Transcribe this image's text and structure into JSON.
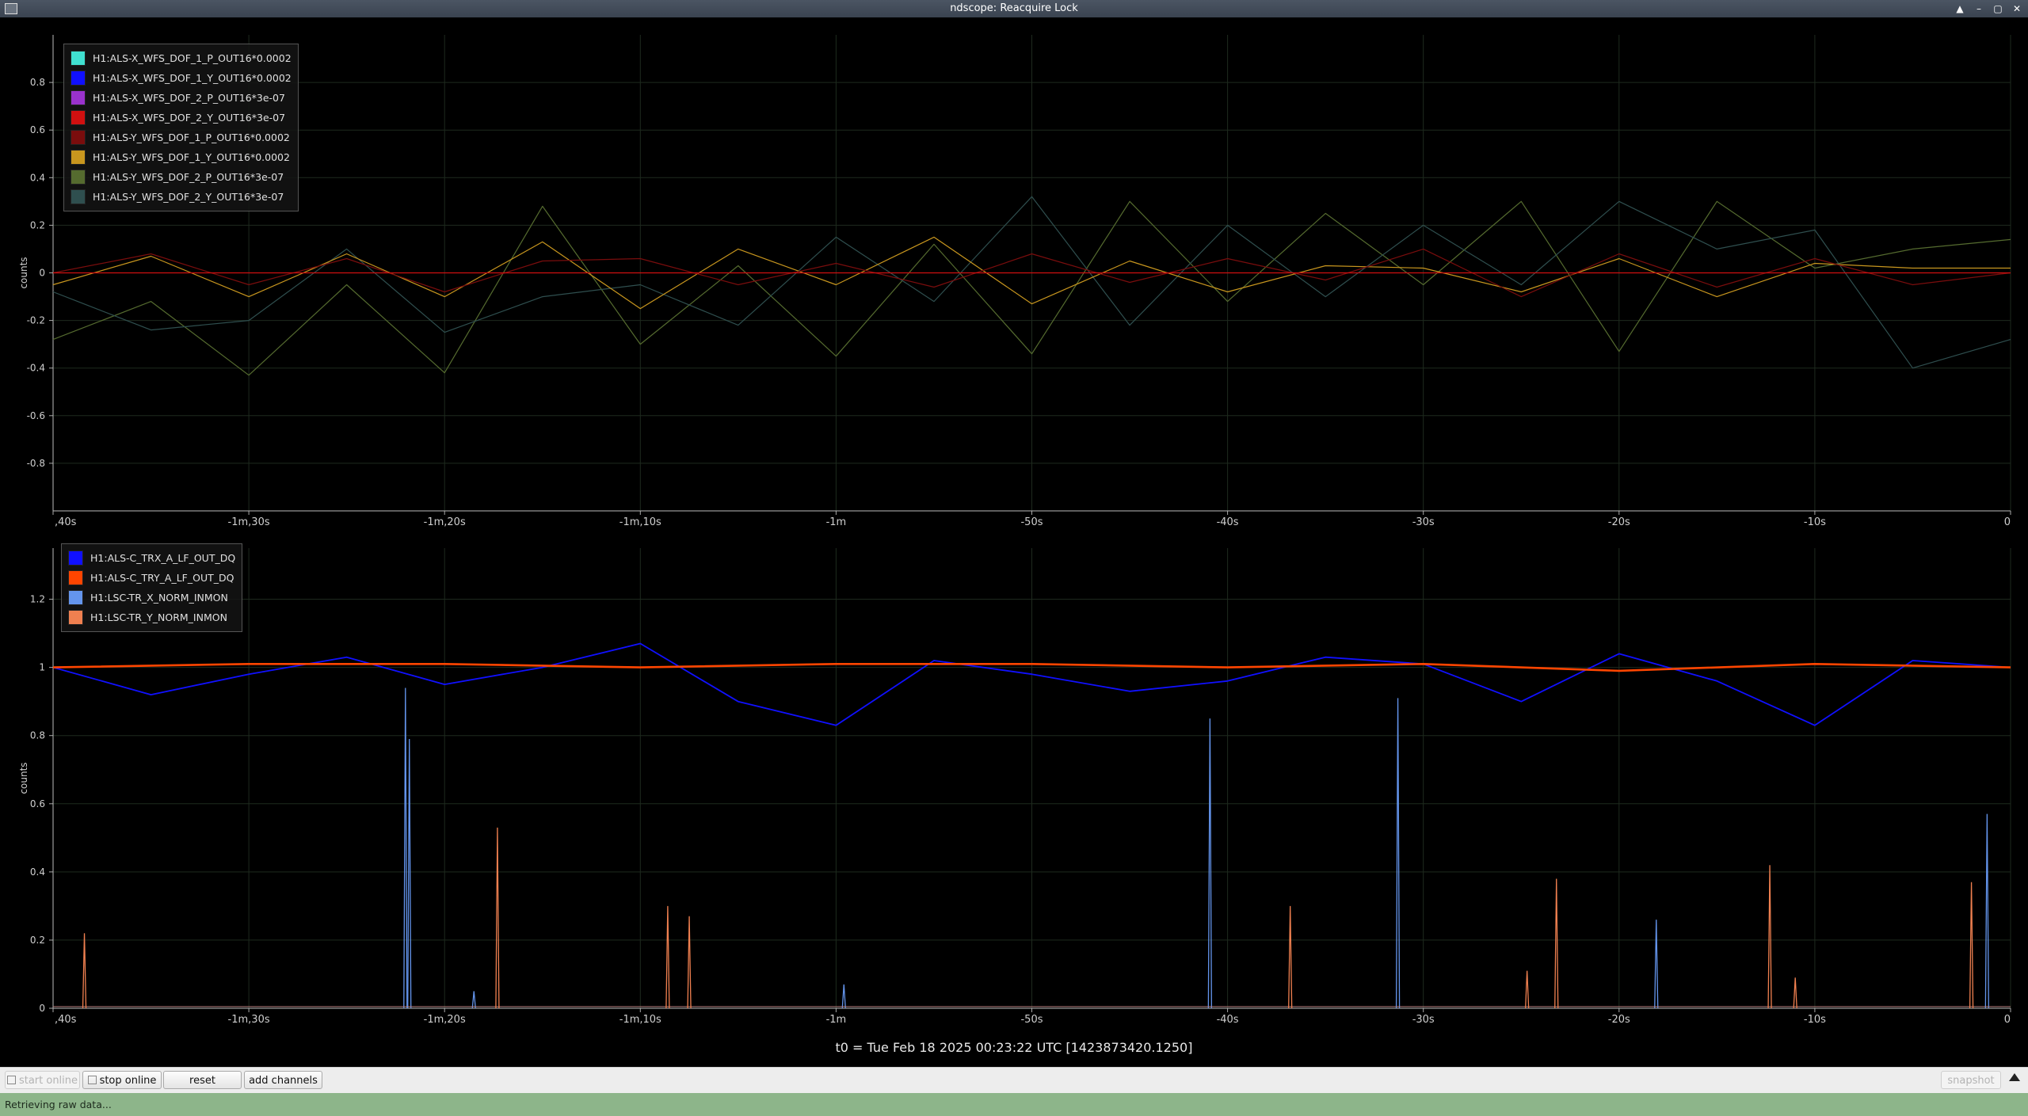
{
  "window": {
    "title": "ndscope: Reacquire Lock",
    "controls": [
      "▲",
      "–",
      "▢",
      "✕"
    ]
  },
  "plot1": {
    "y_label": "counts",
    "legend": [
      {
        "label": "H1:ALS-X_WFS_DOF_1_P_OUT16*0.0002",
        "color": "#40e0d0"
      },
      {
        "label": "H1:ALS-X_WFS_DOF_1_Y_OUT16*0.0002",
        "color": "#1010ff"
      },
      {
        "label": "H1:ALS-X_WFS_DOF_2_P_OUT16*3e-07",
        "color": "#9932cc"
      },
      {
        "label": "H1:ALS-X_WFS_DOF_2_Y_OUT16*3e-07",
        "color": "#d01010"
      },
      {
        "label": "H1:ALS-Y_WFS_DOF_1_P_OUT16*0.0002",
        "color": "#7a0d0d"
      },
      {
        "label": "H1:ALS-Y_WFS_DOF_1_Y_OUT16*0.0002",
        "color": "#c8961e"
      },
      {
        "label": "H1:ALS-Y_WFS_DOF_2_P_OUT16*3e-07",
        "color": "#556b2f"
      },
      {
        "label": "H1:ALS-Y_WFS_DOF_2_Y_OUT16*3e-07",
        "color": "#2f4f4f"
      }
    ],
    "y_ticks": [
      "0.8",
      "0.6",
      "0.4",
      "0.2",
      "0",
      "-0.2",
      "-0.4",
      "-0.6",
      "-0.8"
    ],
    "x_ticks": [
      ",40s",
      "-1m,30s",
      "-1m,20s",
      "-1m,10s",
      "-1m",
      "-50s",
      "-40s",
      "-30s",
      "-20s",
      "-10s",
      "0"
    ]
  },
  "plot2": {
    "y_label": "counts",
    "legend": [
      {
        "label": "H1:ALS-C_TRX_A_LF_OUT_DQ",
        "color": "#1010ff"
      },
      {
        "label": "H1:ALS-C_TRY_A_LF_OUT_DQ",
        "color": "#ff4500"
      },
      {
        "label": "H1:LSC-TR_X_NORM_INMON",
        "color": "#6495ed"
      },
      {
        "label": "H1:LSC-TR_Y_NORM_INMON",
        "color": "#f08050"
      }
    ],
    "y_ticks": [
      "1.2",
      "1",
      "0.8",
      "0.6",
      "0.4",
      "0.2",
      "0"
    ],
    "x_ticks": [
      ",40s",
      "-1m,30s",
      "-1m,20s",
      "-1m,10s",
      "-1m",
      "-50s",
      "-40s",
      "-30s",
      "-20s",
      "-10s",
      "0"
    ]
  },
  "chart_data": [
    {
      "type": "line",
      "ylabel": "counts",
      "ylim": [
        -1,
        1
      ],
      "xlim_seconds": [
        -100,
        0
      ],
      "grid": true,
      "legend_position": "top-left",
      "series": [
        {
          "name": "H1:ALS-Y_WFS_DOF_2_P_OUT16*3e-07",
          "color": "#556b2f",
          "x": [
            -100,
            -95,
            -90,
            -85,
            -80,
            -75,
            -70,
            -65,
            -60,
            -55,
            -50,
            -45,
            -40,
            -35,
            -30,
            -25,
            -20,
            -15,
            -10,
            -5,
            0
          ],
          "values": [
            -0.28,
            -0.12,
            -0.43,
            -0.05,
            -0.42,
            0.28,
            -0.3,
            0.03,
            -0.35,
            0.12,
            -0.34,
            0.3,
            -0.12,
            0.25,
            -0.05,
            0.3,
            -0.33,
            0.3,
            0.02,
            0.1,
            0.14
          ]
        },
        {
          "name": "H1:ALS-Y_WFS_DOF_2_Y_OUT16*3e-07",
          "color": "#2f4f4f",
          "x": [
            -100,
            -95,
            -90,
            -85,
            -80,
            -75,
            -70,
            -65,
            -60,
            -55,
            -50,
            -45,
            -40,
            -35,
            -30,
            -25,
            -20,
            -15,
            -10,
            -5,
            0
          ],
          "values": [
            -0.08,
            -0.24,
            -0.2,
            0.1,
            -0.25,
            -0.1,
            -0.05,
            -0.22,
            0.15,
            -0.12,
            0.32,
            -0.22,
            0.2,
            -0.1,
            0.2,
            -0.05,
            0.3,
            0.1,
            0.18,
            -0.4,
            -0.28
          ]
        },
        {
          "name": "H1:ALS-Y_WFS_DOF_1_Y_OUT16*0.0002",
          "color": "#c8961e",
          "x": [
            -100,
            -95,
            -90,
            -85,
            -80,
            -75,
            -70,
            -65,
            -60,
            -55,
            -50,
            -45,
            -40,
            -35,
            -30,
            -25,
            -20,
            -15,
            -10,
            -5,
            0
          ],
          "values": [
            -0.05,
            0.07,
            -0.1,
            0.08,
            -0.1,
            0.13,
            -0.15,
            0.1,
            -0.05,
            0.15,
            -0.13,
            0.05,
            -0.08,
            0.03,
            0.02,
            -0.08,
            0.06,
            -0.1,
            0.04,
            0.02,
            0.02
          ]
        },
        {
          "name": "H1:ALS-Y_WFS_DOF_1_P_OUT16*0.0002",
          "color": "#7a0d0d",
          "x": [
            -100,
            -95,
            -90,
            -85,
            -80,
            -75,
            -70,
            -65,
            -60,
            -55,
            -50,
            -45,
            -40,
            -35,
            -30,
            -25,
            -20,
            -15,
            -10,
            -5,
            0
          ],
          "values": [
            0,
            0.08,
            -0.05,
            0.06,
            -0.08,
            0.05,
            0.06,
            -0.05,
            0.04,
            -0.06,
            0.08,
            -0.04,
            0.06,
            -0.03,
            0.1,
            -0.1,
            0.08,
            -0.06,
            0.06,
            -0.05,
            0
          ]
        },
        {
          "name": "H1:ALS-X_WFS_DOF_2_Y_OUT16*3e-07",
          "color": "#d01010",
          "x": [
            -100,
            0
          ],
          "values": [
            0,
            0
          ]
        }
      ]
    },
    {
      "type": "line",
      "ylabel": "counts",
      "ylim": [
        0,
        1.35
      ],
      "xlim_seconds": [
        -100,
        0
      ],
      "grid": true,
      "legend_position": "top-left",
      "series": [
        {
          "name": "H1:ALS-C_TRX_A_LF_OUT_DQ",
          "color": "#1010ff",
          "x": [
            -100,
            -95,
            -90,
            -85,
            -80,
            -75,
            -70,
            -65,
            -60,
            -55,
            -50,
            -45,
            -40,
            -35,
            -30,
            -25,
            -20,
            -15,
            -10,
            -5,
            0
          ],
          "values": [
            1.0,
            0.92,
            0.98,
            1.03,
            0.95,
            1.0,
            1.07,
            0.9,
            0.83,
            1.02,
            0.98,
            0.93,
            0.96,
            1.03,
            1.01,
            0.9,
            1.04,
            0.96,
            0.83,
            1.02,
            1.0
          ]
        },
        {
          "name": "H1:ALS-C_TRY_A_LF_OUT_DQ",
          "color": "#ff4500",
          "x": [
            -100,
            -90,
            -80,
            -70,
            -60,
            -50,
            -40,
            -30,
            -20,
            -10,
            0
          ],
          "values": [
            1.0,
            1.01,
            1.01,
            1.0,
            1.01,
            1.01,
            1.0,
            1.01,
            0.99,
            1.01,
            1.0
          ]
        },
        {
          "name": "H1:LSC-TR_X_NORM_INMON",
          "color": "#6495ed",
          "x": [
            -82,
            -81.8,
            -78.5,
            -59.6,
            -40.9,
            -31.3,
            -18.1,
            -1.2
          ],
          "values": [
            0.94,
            0.79,
            0.05,
            0.07,
            0.85,
            0.91,
            0.26,
            0.57
          ]
        },
        {
          "name": "H1:LSC-TR_Y_NORM_INMON",
          "color": "#f08050",
          "x": [
            -98.4,
            -77.3,
            -68.6,
            -67.5,
            -36.8,
            -24.7,
            -23.2,
            -12.3,
            -11.0,
            -2.0
          ],
          "values": [
            0.22,
            0.53,
            0.3,
            0.27,
            0.3,
            0.11,
            0.38,
            0.42,
            0.09,
            0.37
          ]
        }
      ]
    }
  ],
  "t0_label": "t0 = Tue Feb 18 2025 00:23:22 UTC [1423873420.1250]",
  "toolbar": {
    "start_online": "start online",
    "stop_online": "stop online",
    "reset": "reset",
    "add_channels": "add channels",
    "snapshot": "snapshot"
  },
  "status": "Retrieving raw data..."
}
